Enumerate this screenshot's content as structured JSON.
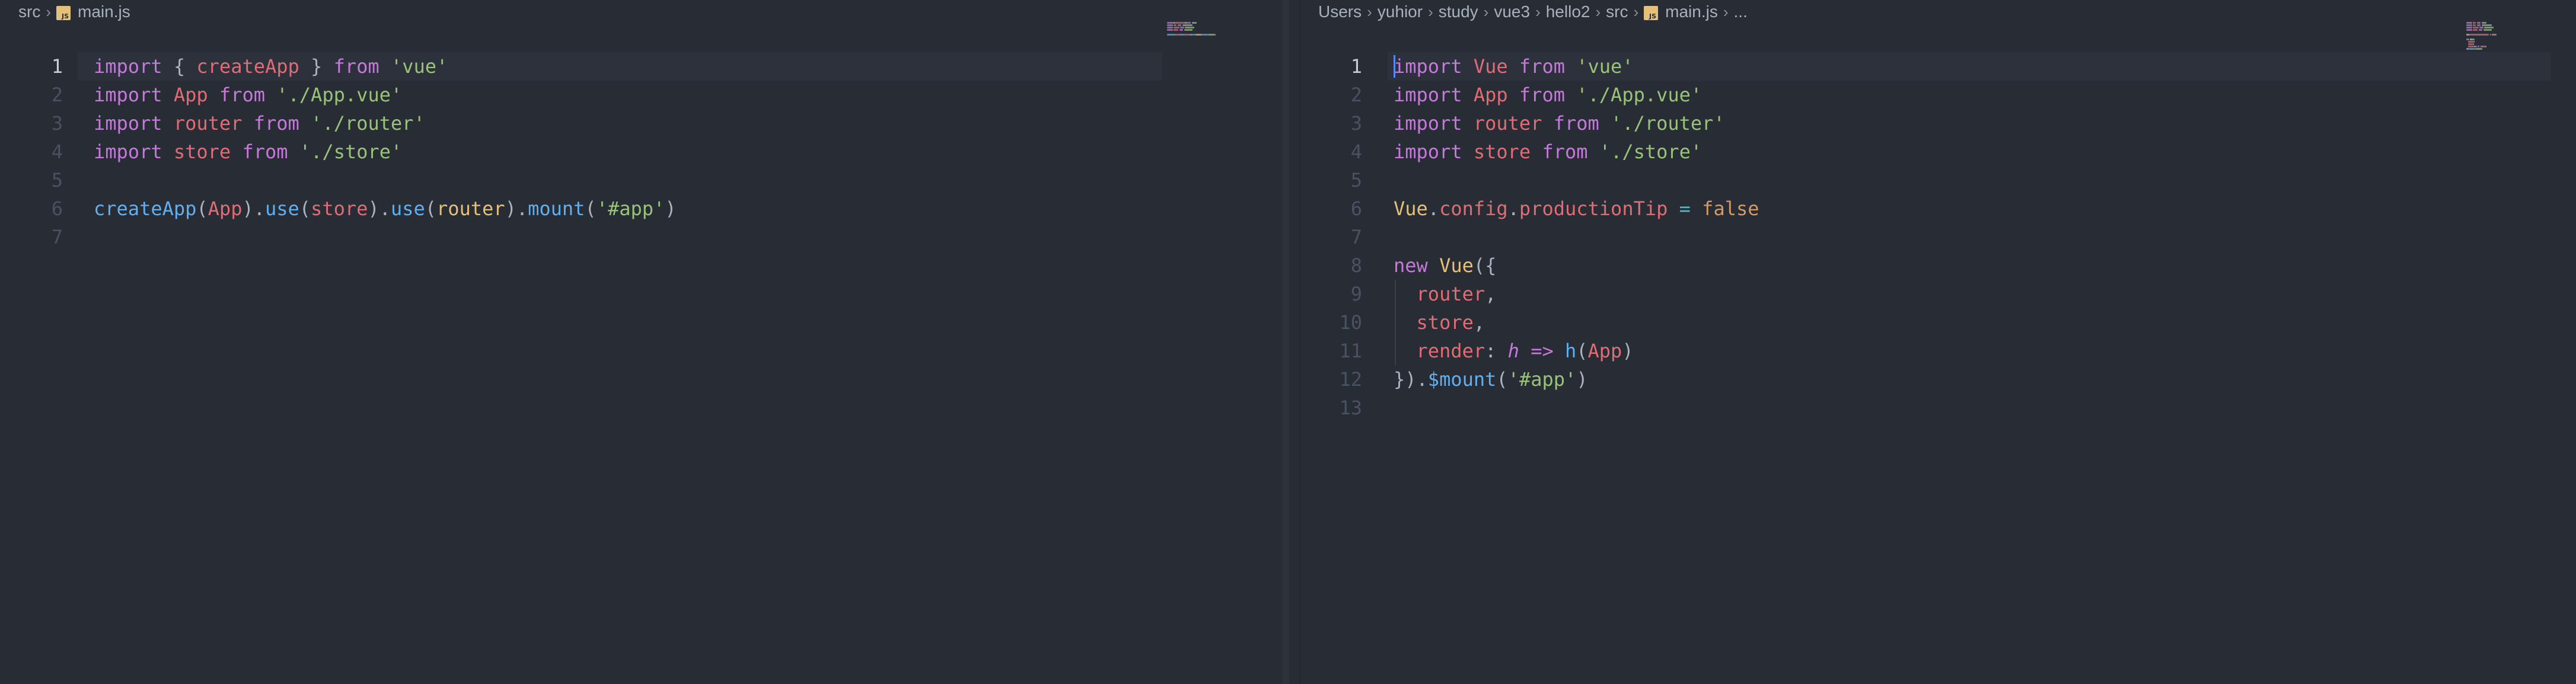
{
  "left_pane": {
    "breadcrumb": [
      "src",
      "main.js"
    ],
    "lines": [
      {
        "n": "1",
        "current": true,
        "tokens": [
          {
            "t": "import",
            "c": "k"
          },
          {
            "t": " { ",
            "c": "p"
          },
          {
            "t": "createApp",
            "c": "v"
          },
          {
            "t": " } ",
            "c": "p"
          },
          {
            "t": "from",
            "c": "k"
          },
          {
            "t": " ",
            "c": "p"
          },
          {
            "t": "'vue'",
            "c": "s"
          }
        ]
      },
      {
        "n": "2",
        "tokens": [
          {
            "t": "import",
            "c": "k"
          },
          {
            "t": " ",
            "c": "p"
          },
          {
            "t": "App",
            "c": "v"
          },
          {
            "t": " ",
            "c": "p"
          },
          {
            "t": "from",
            "c": "k"
          },
          {
            "t": " ",
            "c": "p"
          },
          {
            "t": "'./App.vue'",
            "c": "s"
          }
        ]
      },
      {
        "n": "3",
        "tokens": [
          {
            "t": "import",
            "c": "k"
          },
          {
            "t": " ",
            "c": "p"
          },
          {
            "t": "router",
            "c": "v"
          },
          {
            "t": " ",
            "c": "p"
          },
          {
            "t": "from",
            "c": "k"
          },
          {
            "t": " ",
            "c": "p"
          },
          {
            "t": "'./router'",
            "c": "s"
          }
        ]
      },
      {
        "n": "4",
        "tokens": [
          {
            "t": "import",
            "c": "k"
          },
          {
            "t": " ",
            "c": "p"
          },
          {
            "t": "store",
            "c": "v"
          },
          {
            "t": " ",
            "c": "p"
          },
          {
            "t": "from",
            "c": "k"
          },
          {
            "t": " ",
            "c": "p"
          },
          {
            "t": "'./store'",
            "c": "s"
          }
        ]
      },
      {
        "n": "5",
        "tokens": []
      },
      {
        "n": "6",
        "tokens": [
          {
            "t": "createApp",
            "c": "f"
          },
          {
            "t": "(",
            "c": "p"
          },
          {
            "t": "App",
            "c": "v"
          },
          {
            "t": ").",
            "c": "p"
          },
          {
            "t": "use",
            "c": "f"
          },
          {
            "t": "(",
            "c": "p"
          },
          {
            "t": "store",
            "c": "v"
          },
          {
            "t": ").",
            "c": "p"
          },
          {
            "t": "use",
            "c": "f"
          },
          {
            "t": "(",
            "c": "p"
          },
          {
            "t": "router",
            "c": "y"
          },
          {
            "t": ").",
            "c": "p"
          },
          {
            "t": "mount",
            "c": "f"
          },
          {
            "t": "(",
            "c": "p"
          },
          {
            "t": "'#app'",
            "c": "s"
          },
          {
            "t": ")",
            "c": "p"
          }
        ]
      },
      {
        "n": "7",
        "tokens": []
      }
    ]
  },
  "right_pane": {
    "breadcrumb": [
      "Users",
      "yuhior",
      "study",
      "vue3",
      "hello2",
      "src",
      "main.js",
      "..."
    ],
    "lines": [
      {
        "n": "1",
        "current": true,
        "cursor": true,
        "tokens": [
          {
            "t": "import",
            "c": "k"
          },
          {
            "t": " ",
            "c": "p"
          },
          {
            "t": "Vue",
            "c": "v"
          },
          {
            "t": " ",
            "c": "p"
          },
          {
            "t": "from",
            "c": "k"
          },
          {
            "t": " ",
            "c": "p"
          },
          {
            "t": "'vue'",
            "c": "s"
          }
        ]
      },
      {
        "n": "2",
        "tokens": [
          {
            "t": "import",
            "c": "k"
          },
          {
            "t": " ",
            "c": "p"
          },
          {
            "t": "App",
            "c": "v"
          },
          {
            "t": " ",
            "c": "p"
          },
          {
            "t": "from",
            "c": "k"
          },
          {
            "t": " ",
            "c": "p"
          },
          {
            "t": "'./App.vue'",
            "c": "s"
          }
        ]
      },
      {
        "n": "3",
        "tokens": [
          {
            "t": "import",
            "c": "k"
          },
          {
            "t": " ",
            "c": "p"
          },
          {
            "t": "router",
            "c": "v"
          },
          {
            "t": " ",
            "c": "p"
          },
          {
            "t": "from",
            "c": "k"
          },
          {
            "t": " ",
            "c": "p"
          },
          {
            "t": "'./router'",
            "c": "s"
          }
        ]
      },
      {
        "n": "4",
        "tokens": [
          {
            "t": "import",
            "c": "k"
          },
          {
            "t": " ",
            "c": "p"
          },
          {
            "t": "store",
            "c": "v"
          },
          {
            "t": " ",
            "c": "p"
          },
          {
            "t": "from",
            "c": "k"
          },
          {
            "t": " ",
            "c": "p"
          },
          {
            "t": "'./store'",
            "c": "s"
          }
        ]
      },
      {
        "n": "5",
        "tokens": []
      },
      {
        "n": "6",
        "tokens": [
          {
            "t": "Vue",
            "c": "y"
          },
          {
            "t": ".",
            "c": "p"
          },
          {
            "t": "config",
            "c": "v"
          },
          {
            "t": ".",
            "c": "p"
          },
          {
            "t": "productionTip",
            "c": "v"
          },
          {
            "t": " ",
            "c": "p"
          },
          {
            "t": "=",
            "c": "c"
          },
          {
            "t": " ",
            "c": "p"
          },
          {
            "t": "false",
            "c": "o"
          }
        ]
      },
      {
        "n": "7",
        "tokens": []
      },
      {
        "n": "8",
        "tokens": [
          {
            "t": "new",
            "c": "k"
          },
          {
            "t": " ",
            "c": "p"
          },
          {
            "t": "Vue",
            "c": "y"
          },
          {
            "t": "({",
            "c": "p"
          }
        ]
      },
      {
        "n": "9",
        "indent": true,
        "tokens": [
          {
            "t": "  ",
            "c": "p"
          },
          {
            "t": "router",
            "c": "v"
          },
          {
            "t": ",",
            "c": "p"
          }
        ]
      },
      {
        "n": "10",
        "indent": true,
        "tokens": [
          {
            "t": "  ",
            "c": "p"
          },
          {
            "t": "store",
            "c": "v"
          },
          {
            "t": ",",
            "c": "p"
          }
        ]
      },
      {
        "n": "11",
        "indent": true,
        "tokens": [
          {
            "t": "  ",
            "c": "p"
          },
          {
            "t": "render",
            "c": "v"
          },
          {
            "t": ": ",
            "c": "p"
          },
          {
            "t": "h",
            "c": "i"
          },
          {
            "t": " ",
            "c": "p"
          },
          {
            "t": "=>",
            "c": "k"
          },
          {
            "t": " ",
            "c": "p"
          },
          {
            "t": "h",
            "c": "f"
          },
          {
            "t": "(",
            "c": "p"
          },
          {
            "t": "App",
            "c": "v"
          },
          {
            "t": ")",
            "c": "p"
          }
        ]
      },
      {
        "n": "12",
        "tokens": [
          {
            "t": "}).",
            "c": "p"
          },
          {
            "t": "$mount",
            "c": "f"
          },
          {
            "t": "(",
            "c": "p"
          },
          {
            "t": "'#app'",
            "c": "s"
          },
          {
            "t": ")",
            "c": "p"
          }
        ]
      },
      {
        "n": "13",
        "tokens": []
      }
    ]
  },
  "colors": {
    "background": "#282c34",
    "keyword": "#c678dd",
    "variable": "#e06c75",
    "string": "#98c379",
    "function": "#61afef",
    "class": "#e5c07b",
    "number": "#d19a66",
    "operator": "#56b6c2",
    "plain": "#abb2bf",
    "js_icon": "#e5c07b"
  }
}
